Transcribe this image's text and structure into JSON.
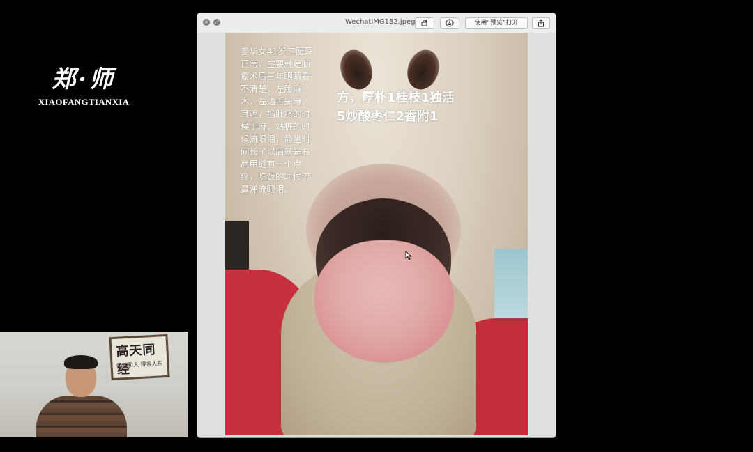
{
  "logo": {
    "main": "郑·师",
    "sub": "XIAOFANGTIANXIA"
  },
  "webcam": {
    "board_main": "高天同经",
    "board_small": "朝鲜和人 得言人东"
  },
  "window": {
    "title": "WechatIMG182.jpeg",
    "open_with_label": "使用“预览”打开",
    "rotate_icon": "rotate-icon",
    "markup_icon": "markup-icon",
    "share_icon": "share-icon"
  },
  "photo": {
    "case_text": "姜华女41岁二便算正常，主要就是脑瘤术后三年眼睛看不清楚，左脸麻木，左边舌头麻，耳鸣，掐肚脐的时候手麻，站桩的时候流眼泪，静坐时间长了以后就是右肩甲缝有一个点疼，吃饭的时候流鼻涕流眼泪。",
    "prescription_text": "方，厚朴1桂枝1独活5炒酸枣仁2香附1"
  }
}
